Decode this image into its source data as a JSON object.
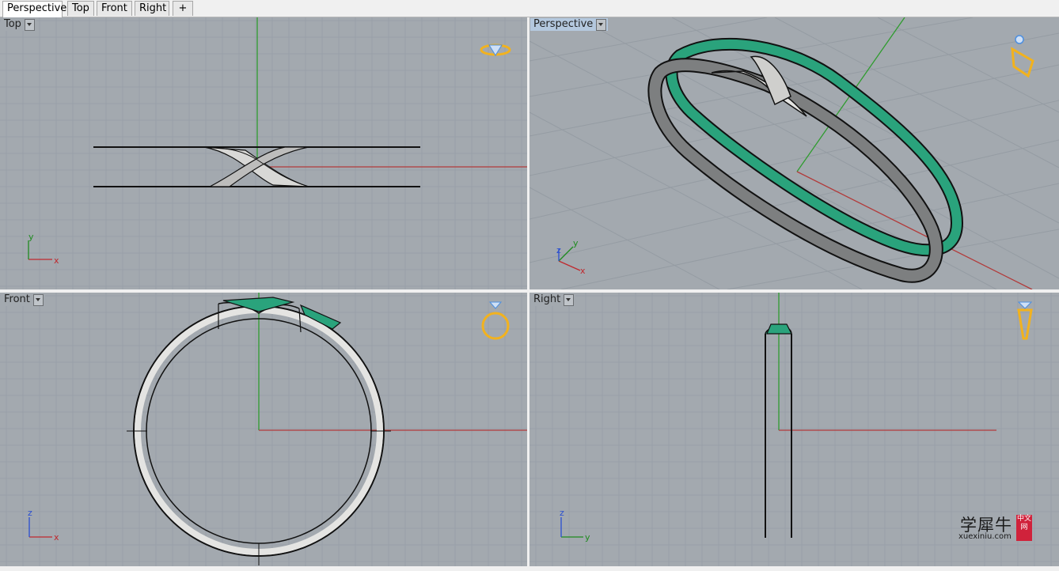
{
  "tabs": [
    {
      "label": "Perspective",
      "active": true
    },
    {
      "label": "Top",
      "active": false
    },
    {
      "label": "Front",
      "active": false
    },
    {
      "label": "Right",
      "active": false
    }
  ],
  "new_tab_glyph": "+",
  "viewports": {
    "top": {
      "label": "Top"
    },
    "perspective": {
      "label": "Perspective"
    },
    "front": {
      "label": "Front"
    },
    "right": {
      "label": "Right"
    }
  },
  "axes": {
    "top": {
      "a": "x",
      "b": "y"
    },
    "perspective": {
      "a": "x",
      "b": "y",
      "c": "z"
    },
    "front": {
      "a": "x",
      "b": "z"
    },
    "right": {
      "a": "y",
      "b": "z"
    }
  },
  "watermark": {
    "name": "学犀牛",
    "url": "xuexiniu.com",
    "badge": "中文网"
  },
  "colors": {
    "viewport_bg": "#a3a9af",
    "grid_minor": "#98a0a8",
    "grid_major": "#8a9299",
    "x_axis": "#b23a3a",
    "y_axis": "#2f9c2f",
    "ring_green": "#2aa37c",
    "ring_white": "#e4e4e2",
    "ring_grey": "#7d7f80",
    "active_label": "#b4c8de",
    "gumball_gold": "#f2b21e",
    "gumball_blue": "#4c8fe0"
  },
  "icons": [
    "add-tab-icon",
    "dropdown-icon",
    "ring-view-icon",
    "axis-indicator-icon"
  ]
}
